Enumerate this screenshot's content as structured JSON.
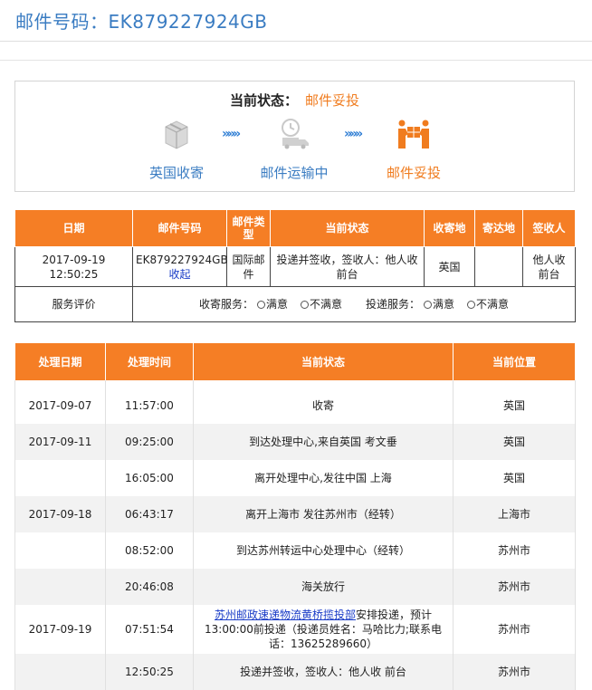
{
  "header": {
    "title": "邮件号码：EK879227924GB"
  },
  "status": {
    "label": "当前状态：",
    "value": "邮件妥投",
    "steps": [
      {
        "label": "英国收寄",
        "icon": "package-icon",
        "active": false
      },
      {
        "label": "邮件运输中",
        "icon": "delivery-truck-icon",
        "active": false
      },
      {
        "label": "邮件妥投",
        "icon": "handover-icon",
        "active": true
      }
    ],
    "arrow": "»»»",
    "colors": {
      "active": "#f07c1f",
      "inactive": "#3a7cc2",
      "header_bg": "#f57e25"
    }
  },
  "summary": {
    "headers": [
      "日期",
      "邮件号码",
      "邮件类型",
      "当前状态",
      "收寄地",
      "寄达地",
      "签收人"
    ],
    "row": {
      "date": "2017-09-19 12:50:25",
      "mail_no": "EK879227924GB",
      "collapse_link": "收起",
      "type": "国际邮件",
      "status": "投递并签收，签收人：他人收 前台",
      "origin": "英国",
      "destination": "",
      "signer": "他人收 前台"
    },
    "rating": {
      "label": "服务评价",
      "collect_label": "收寄服务：",
      "deliver_label": "投递服务：",
      "satisfied": "满意",
      "unsatisfied": "不满意"
    }
  },
  "detail": {
    "headers": [
      "处理日期",
      "处理时间",
      "当前状态",
      "当前位置"
    ],
    "rows": [
      {
        "date": "2017-09-07",
        "time": "11:57:00",
        "status": "收寄",
        "location": "英国"
      },
      {
        "date": "2017-09-11",
        "time": "09:25:00",
        "status": "到达处理中心,来自英国 考文垂",
        "location": "英国"
      },
      {
        "date": "",
        "time": "16:05:00",
        "status": "离开处理中心,发往中国 上海",
        "location": "英国"
      },
      {
        "date": "2017-09-18",
        "time": "06:43:17",
        "status": "离开上海市 发往苏州市（经转）",
        "location": "上海市"
      },
      {
        "date": "",
        "time": "08:52:00",
        "status": "到达苏州转运中心处理中心（经转）",
        "location": "苏州市"
      },
      {
        "date": "",
        "time": "20:46:08",
        "status": "海关放行",
        "location": "苏州市"
      },
      {
        "date": "2017-09-19",
        "time": "07:51:54",
        "status_link": "苏州邮政速递物流黄桥揽投部",
        "status": "安排投递，预计13:00:00前投递（投递员姓名：马哈比力;联系电话：13625289660）",
        "location": "苏州市"
      },
      {
        "date": "",
        "time": "12:50:25",
        "status": "投递并签收，签收人：他人收 前台",
        "location": "苏州市"
      }
    ]
  }
}
